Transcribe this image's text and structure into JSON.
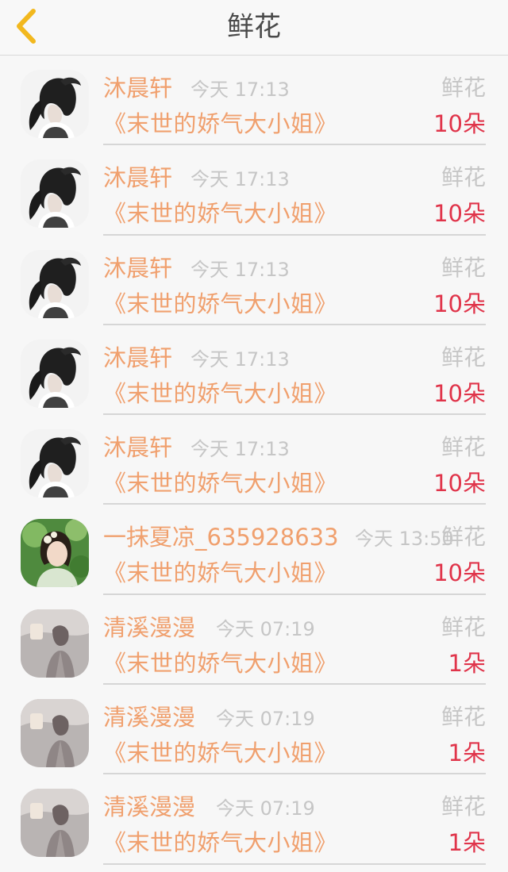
{
  "header": {
    "title": "鲜花",
    "back_icon": "chevron-left-icon"
  },
  "colors": {
    "accent": "#f0a06e",
    "count": "#e0344a",
    "back": "#f2b81e",
    "muted": "#c6c6c6"
  },
  "items": [
    {
      "sender": "沐晨轩",
      "time": "今天 17:13",
      "gift": "鲜花",
      "book": "《末世的娇气大小姐》",
      "count": "10朵",
      "avatar": "avatar-girl-ponytail"
    },
    {
      "sender": "沐晨轩",
      "time": "今天 17:13",
      "gift": "鲜花",
      "book": "《末世的娇气大小姐》",
      "count": "10朵",
      "avatar": "avatar-girl-ponytail"
    },
    {
      "sender": "沐晨轩",
      "time": "今天 17:13",
      "gift": "鲜花",
      "book": "《末世的娇气大小姐》",
      "count": "10朵",
      "avatar": "avatar-girl-ponytail"
    },
    {
      "sender": "沐晨轩",
      "time": "今天 17:13",
      "gift": "鲜花",
      "book": "《末世的娇气大小姐》",
      "count": "10朵",
      "avatar": "avatar-girl-ponytail"
    },
    {
      "sender": "沐晨轩",
      "time": "今天 17:13",
      "gift": "鲜花",
      "book": "《末世的娇气大小姐》",
      "count": "10朵",
      "avatar": "avatar-girl-ponytail"
    },
    {
      "sender": "一抹夏凉_635928633",
      "time": "今天 13:50",
      "gift": "鲜花",
      "book": "《末世的娇气大小姐》",
      "count": "10朵",
      "avatar": "avatar-green-portrait"
    },
    {
      "sender": "清溪漫漫",
      "time": "今天 07:19",
      "gift": "鲜花",
      "book": "《末世的娇气大小姐》",
      "count": "1朵",
      "avatar": "avatar-gray-sketch"
    },
    {
      "sender": "清溪漫漫",
      "time": "今天 07:19",
      "gift": "鲜花",
      "book": "《末世的娇气大小姐》",
      "count": "1朵",
      "avatar": "avatar-gray-sketch"
    },
    {
      "sender": "清溪漫漫",
      "time": "今天 07:19",
      "gift": "鲜花",
      "book": "《末世的娇气大小姐》",
      "count": "1朵",
      "avatar": "avatar-gray-sketch"
    }
  ]
}
